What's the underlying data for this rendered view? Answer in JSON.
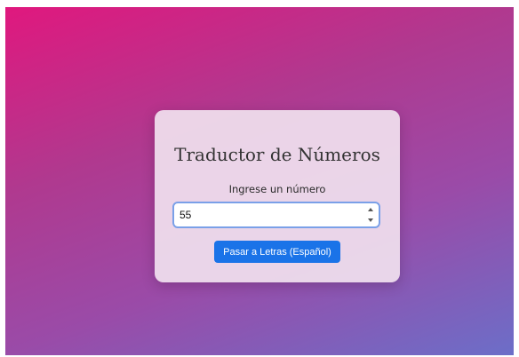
{
  "card": {
    "title": "Traductor de Números",
    "input_label": "Ingrese un número",
    "input_value": "55",
    "input_type": "number",
    "button_label": "Pasar a Letras (Español)"
  },
  "icons": {
    "spinner_up": "chevron-up-icon",
    "spinner_down": "chevron-down-icon"
  },
  "colors": {
    "gradient_start": "#e0187e",
    "gradient_end": "#6c6ec8",
    "button": "#1a73e8",
    "input_focus_border": "#7aa0e8"
  }
}
